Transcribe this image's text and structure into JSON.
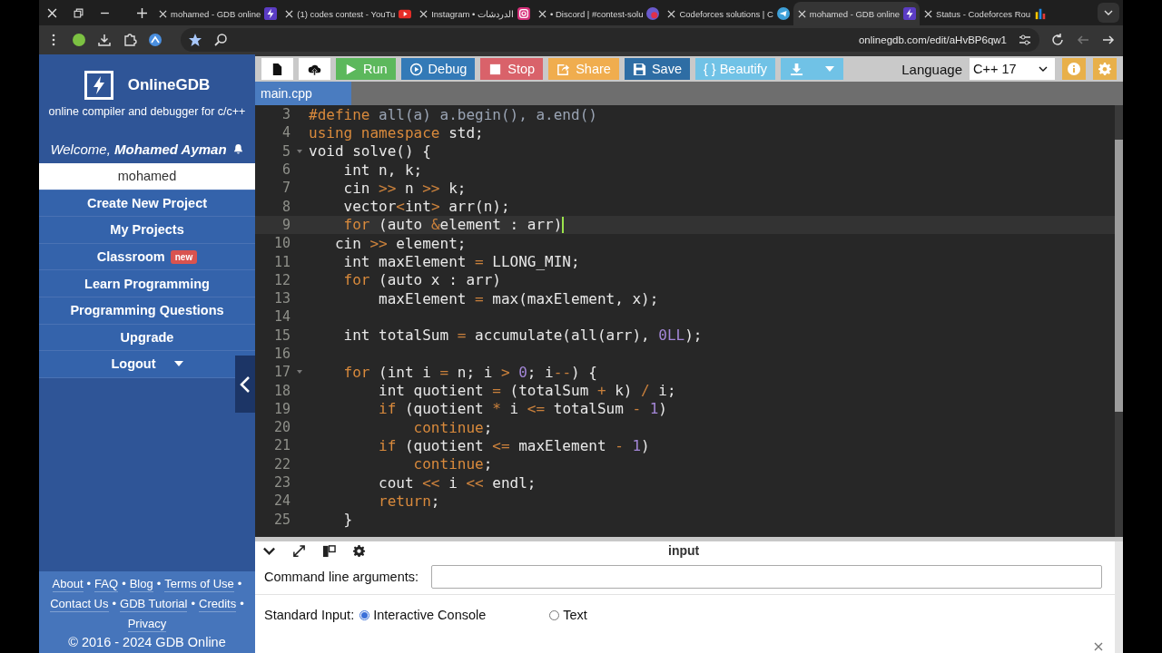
{
  "browser": {
    "tabs": [
      {
        "title": "mohamed - GDB online",
        "kind": "lightning",
        "selected": false
      },
      {
        "title": "(1) codes contest - YouTu",
        "kind": "play",
        "selected": false
      },
      {
        "title": "Instagram • الدردشات",
        "kind": "camera",
        "selected": false
      },
      {
        "title": "• Discord | #contest-solu",
        "kind": "round",
        "selected": false
      },
      {
        "title": "Codeforces solutions | C",
        "kind": "plane",
        "selected": false
      },
      {
        "title": "mohamed - GDB online",
        "kind": "lightning",
        "selected": true
      },
      {
        "title": "Status - Codeforces Rou",
        "kind": "bars",
        "selected": false
      }
    ],
    "url": "onlinegdb.com/edit/aHvBP6qw1"
  },
  "sidebar": {
    "logo": {
      "title": "OnlineGDB",
      "subtitle": "online compiler and debugger for c/c++"
    },
    "welcome": "Welcome, **Mohamed Ayman**",
    "items": [
      {
        "label": "mohamed",
        "selected": true
      },
      {
        "label": "Create New Project",
        "selected": false
      },
      {
        "label": "My Projects",
        "selected": false
      },
      {
        "label": "Classroom",
        "badge": "new",
        "selected": false
      },
      {
        "label": "Learn Programming",
        "selected": false
      },
      {
        "label": "Programming Questions",
        "selected": false
      },
      {
        "label": "Upgrade",
        "selected": false
      },
      {
        "label": "Logout",
        "dropdown": true,
        "selected": false
      }
    ],
    "footer": {
      "links": [
        {
          "label": "About",
          "separator": "•"
        },
        {
          "label": "FAQ",
          "separator": "•"
        },
        {
          "label": "Blog",
          "separator": "•"
        },
        {
          "label": "Terms of Use",
          "separator": "•"
        },
        {
          "label": "Contact Us",
          "separator": "•"
        },
        {
          "label": "GDB Tutorial",
          "separator": "•"
        },
        {
          "label": "Credits",
          "separator": "•"
        },
        {
          "label": "Privacy"
        }
      ],
      "copyright": "© 2016 - 2024 GDB Online"
    }
  },
  "toolbar": {
    "buttons": [
      {
        "kind": "file",
        "color": "#ffffff"
      },
      {
        "kind": "upload",
        "color": "#ffffff"
      },
      {
        "kind": "run",
        "label": "Run",
        "color": "#5cb85c"
      },
      {
        "kind": "debug",
        "label": "Debug",
        "color": "#337ab7"
      },
      {
        "kind": "stop",
        "label": "Stop",
        "color": "#d9626a"
      },
      {
        "kind": "share",
        "label": "Share",
        "color": "#f0ad4e"
      },
      {
        "kind": "save",
        "label": "Save",
        "color": "#2e6da4"
      },
      {
        "kind": "beautify",
        "label": "{ } Beautify",
        "color": "#70c2e6"
      },
      {
        "kind": "download",
        "color": "#70c2e6"
      }
    ],
    "language": {
      "label": "Language",
      "value": "C++ 17"
    }
  },
  "editor": {
    "file_tab": "main.cpp",
    "lines": [
      {
        "number": "3",
        "tokens": [
          {
            "kind": "keyword",
            "text": "#define"
          },
          {
            "kind": "macro",
            "text": " all(a) a.begin(), a.end()"
          }
        ]
      },
      {
        "number": "4",
        "tokens": [
          {
            "kind": "keyword",
            "text": "using namespace"
          },
          {
            "kind": "plain",
            "text": " std;"
          }
        ]
      },
      {
        "number": "5",
        "fold": true,
        "tokens": [
          {
            "kind": "plain",
            "text": "void solve() {"
          }
        ]
      },
      {
        "number": "6",
        "tokens": [
          {
            "kind": "plain",
            "text": "    int n, k;"
          }
        ]
      },
      {
        "number": "7",
        "tokens": [
          {
            "kind": "plain",
            "text": "    cin "
          },
          {
            "kind": "operator",
            "text": ">>"
          },
          {
            "kind": "plain",
            "text": " n "
          },
          {
            "kind": "operator",
            "text": ">>"
          },
          {
            "kind": "plain",
            "text": " k;"
          }
        ]
      },
      {
        "number": "8",
        "tokens": [
          {
            "kind": "plain",
            "text": "    vector"
          },
          {
            "kind": "operator",
            "text": "<"
          },
          {
            "kind": "plain",
            "text": "int"
          },
          {
            "kind": "operator",
            "text": ">"
          },
          {
            "kind": "plain",
            "text": " arr(n);"
          }
        ]
      },
      {
        "number": "9",
        "active": true,
        "tokens": [
          {
            "kind": "keyword",
            "text": "    for"
          },
          {
            "kind": "plain",
            "text": " (auto "
          },
          {
            "kind": "operator",
            "text": "&"
          },
          {
            "kind": "plain",
            "text": "element : arr)"
          }
        ]
      },
      {
        "number": "10",
        "tokens": [
          {
            "kind": "plain",
            "text": "   cin "
          },
          {
            "kind": "operator",
            "text": ">>"
          },
          {
            "kind": "plain",
            "text": " element;"
          }
        ]
      },
      {
        "number": "11",
        "tokens": [
          {
            "kind": "plain",
            "text": "    int maxElement "
          },
          {
            "kind": "operator",
            "text": "="
          },
          {
            "kind": "plain",
            "text": " LLONG_MIN;"
          }
        ]
      },
      {
        "number": "12",
        "tokens": [
          {
            "kind": "keyword",
            "text": "    for"
          },
          {
            "kind": "plain",
            "text": " (auto x : arr)"
          }
        ]
      },
      {
        "number": "13",
        "tokens": [
          {
            "kind": "plain",
            "text": "        maxElement "
          },
          {
            "kind": "operator",
            "text": "="
          },
          {
            "kind": "plain",
            "text": " max(maxElement, x);"
          }
        ]
      },
      {
        "number": "14"
      },
      {
        "number": "15",
        "tokens": [
          {
            "kind": "plain",
            "text": "    int totalSum "
          },
          {
            "kind": "operator",
            "text": "="
          },
          {
            "kind": "plain",
            "text": " accumulate(all(arr), "
          },
          {
            "kind": "number",
            "text": "0LL"
          },
          {
            "kind": "plain",
            "text": ");"
          }
        ]
      },
      {
        "number": "16"
      },
      {
        "number": "17",
        "fold": true,
        "tokens": [
          {
            "kind": "keyword",
            "text": "    for"
          },
          {
            "kind": "plain",
            "text": " (int i "
          },
          {
            "kind": "operator",
            "text": "="
          },
          {
            "kind": "plain",
            "text": " n; i "
          },
          {
            "kind": "operator",
            "text": ">"
          },
          {
            "kind": "number",
            "text": " 0"
          },
          {
            "kind": "plain",
            "text": "; i"
          },
          {
            "kind": "operator",
            "text": "--"
          },
          {
            "kind": "plain",
            "text": ") {"
          }
        ]
      },
      {
        "number": "18",
        "tokens": [
          {
            "kind": "plain",
            "text": "        int quotient "
          },
          {
            "kind": "operator",
            "text": "="
          },
          {
            "kind": "plain",
            "text": " (totalSum "
          },
          {
            "kind": "operator",
            "text": "+"
          },
          {
            "kind": "plain",
            "text": " k) "
          },
          {
            "kind": "operator",
            "text": "/"
          },
          {
            "kind": "plain",
            "text": " i;"
          }
        ]
      },
      {
        "number": "19",
        "tokens": [
          {
            "kind": "keyword",
            "text": "        if"
          },
          {
            "kind": "plain",
            "text": " (quotient "
          },
          {
            "kind": "operator",
            "text": "*"
          },
          {
            "kind": "plain",
            "text": " i "
          },
          {
            "kind": "operator",
            "text": "<="
          },
          {
            "kind": "plain",
            "text": " totalSum "
          },
          {
            "kind": "operator",
            "text": "-"
          },
          {
            "kind": "number",
            "text": " 1"
          },
          {
            "kind": "plain",
            "text": ")"
          }
        ]
      },
      {
        "number": "20",
        "tokens": [
          {
            "kind": "keyword",
            "text": "            continue"
          },
          {
            "kind": "plain",
            "text": ";"
          }
        ]
      },
      {
        "number": "21",
        "tokens": [
          {
            "kind": "keyword",
            "text": "        if"
          },
          {
            "kind": "plain",
            "text": " (quotient "
          },
          {
            "kind": "operator",
            "text": "<="
          },
          {
            "kind": "plain",
            "text": " maxElement "
          },
          {
            "kind": "operator",
            "text": "-"
          },
          {
            "kind": "number",
            "text": " 1"
          },
          {
            "kind": "plain",
            "text": ")"
          }
        ]
      },
      {
        "number": "22",
        "tokens": [
          {
            "kind": "keyword",
            "text": "            continue"
          },
          {
            "kind": "plain",
            "text": ";"
          }
        ]
      },
      {
        "number": "23",
        "tokens": [
          {
            "kind": "plain",
            "text": "        cout "
          },
          {
            "kind": "operator",
            "text": "<<"
          },
          {
            "kind": "plain",
            "text": " i "
          },
          {
            "kind": "operator",
            "text": "<<"
          },
          {
            "kind": "plain",
            "text": " endl;"
          }
        ]
      },
      {
        "number": "24",
        "tokens": [
          {
            "kind": "keyword",
            "text": "        return"
          },
          {
            "kind": "plain",
            "text": ";"
          }
        ]
      },
      {
        "number": "25",
        "tokens": [
          {
            "kind": "plain",
            "text": "    }"
          }
        ]
      }
    ]
  },
  "input_panel": {
    "title": "input",
    "args_label": "Command line arguments:",
    "stdin_label": "Standard Input:",
    "stdin_options": [
      {
        "label": "Interactive Console",
        "selected": true
      },
      {
        "label": "Text",
        "selected": false
      }
    ]
  }
}
